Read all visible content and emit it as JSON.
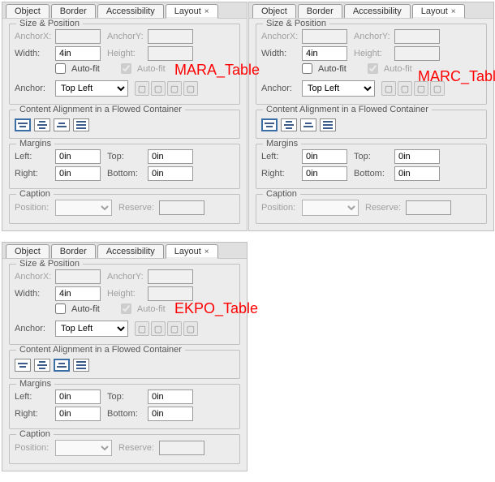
{
  "tabs": {
    "object": "Object",
    "border": "Border",
    "accessibility": "Accessibility",
    "layout": "Layout"
  },
  "groups": {
    "size_position": "Size & Position",
    "content_alignment": "Content Alignment in a Flowed Container",
    "margins": "Margins",
    "caption": "Caption"
  },
  "labels": {
    "anchorx": "AnchorX:",
    "anchory": "AnchorY:",
    "width": "Width:",
    "height": "Height:",
    "autofit": "Auto-fit",
    "anchor": "Anchor:",
    "left": "Left:",
    "top": "Top:",
    "right": "Right:",
    "bottom": "Bottom:",
    "position": "Position:",
    "reserve": "Reserve:"
  },
  "panels": [
    {
      "id": "mara",
      "annotation": "MARA_Table",
      "values": {
        "width": "4in",
        "anchor": "Top Left",
        "left": "0in",
        "top": "0in",
        "right": "0in",
        "bottom": "0in"
      },
      "alignSel": 0
    },
    {
      "id": "marc",
      "annotation": "MARC_Table",
      "values": {
        "width": "4in",
        "anchor": "Top Left",
        "left": "0in",
        "top": "0in",
        "right": "0in",
        "bottom": "0in"
      },
      "alignSel": 0
    },
    {
      "id": "ekpo",
      "annotation": "EKPO_Table",
      "values": {
        "width": "4in",
        "anchor": "Top Left",
        "left": "0in",
        "top": "0in",
        "right": "0in",
        "bottom": "0in"
      },
      "alignSel": 2
    }
  ]
}
